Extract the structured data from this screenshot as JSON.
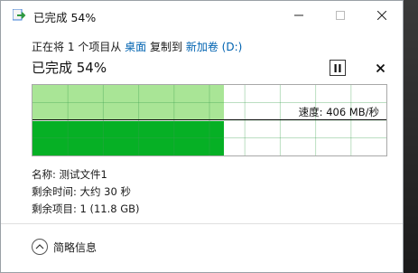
{
  "window": {
    "title": "已完成 54%",
    "controls": {
      "minimize": "minimize",
      "maximize": "maximize",
      "close": "close"
    }
  },
  "copy": {
    "prefix": "正在将",
    "count": "1",
    "middle": "个项目从",
    "source": "桌面",
    "to": "复制到",
    "destination": "新加卷 (D:)"
  },
  "status": {
    "label": "已完成 54%",
    "progress": 0.54
  },
  "graph": {
    "speed_text": "速度: 406 MB/秒"
  },
  "details": {
    "name": "名称: 测试文件1",
    "time_remaining": "剩余时间: 大约 30 秒",
    "items_remaining": "剩余项目: 1 (11.8 GB)"
  },
  "footer": {
    "toggle_label": "简略信息"
  },
  "colors": {
    "fill_light": "#a9e596",
    "fill_dark": "#06b025",
    "link": "#0063b1"
  }
}
